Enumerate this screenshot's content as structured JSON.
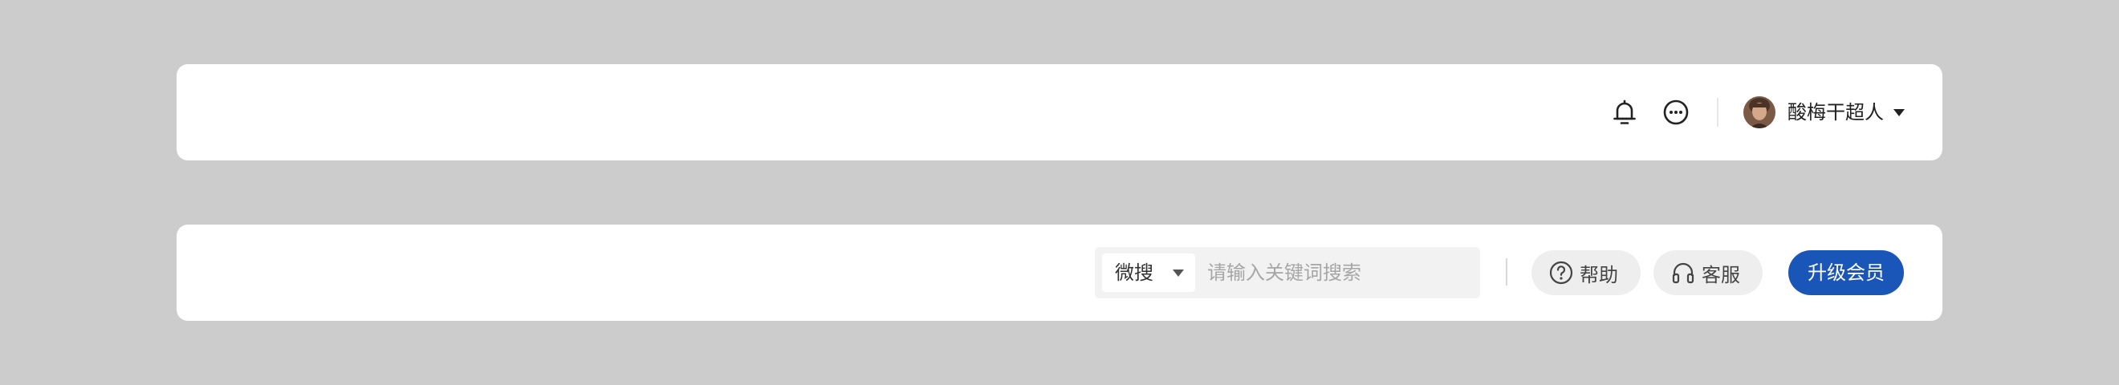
{
  "colors": {
    "page_background": "#cccccc",
    "bar_background": "#ffffff",
    "accent": "#1a56b8",
    "pill_background": "#eeeeee",
    "search_background": "#f2f2f2"
  },
  "top_bar": {
    "icons": {
      "notifications": "bell-icon",
      "messages": "chat-more-icon",
      "dropdown": "caret-down-icon"
    },
    "user": {
      "name": "酸梅干超人"
    }
  },
  "bottom_bar": {
    "search": {
      "scope": "微搜",
      "placeholder": "请输入关键词搜索",
      "value": ""
    },
    "help": {
      "label": "帮助",
      "icon": "help-circle-icon"
    },
    "service": {
      "label": "客服",
      "icon": "headphones-icon"
    },
    "upgrade": {
      "label": "升级会员"
    }
  }
}
